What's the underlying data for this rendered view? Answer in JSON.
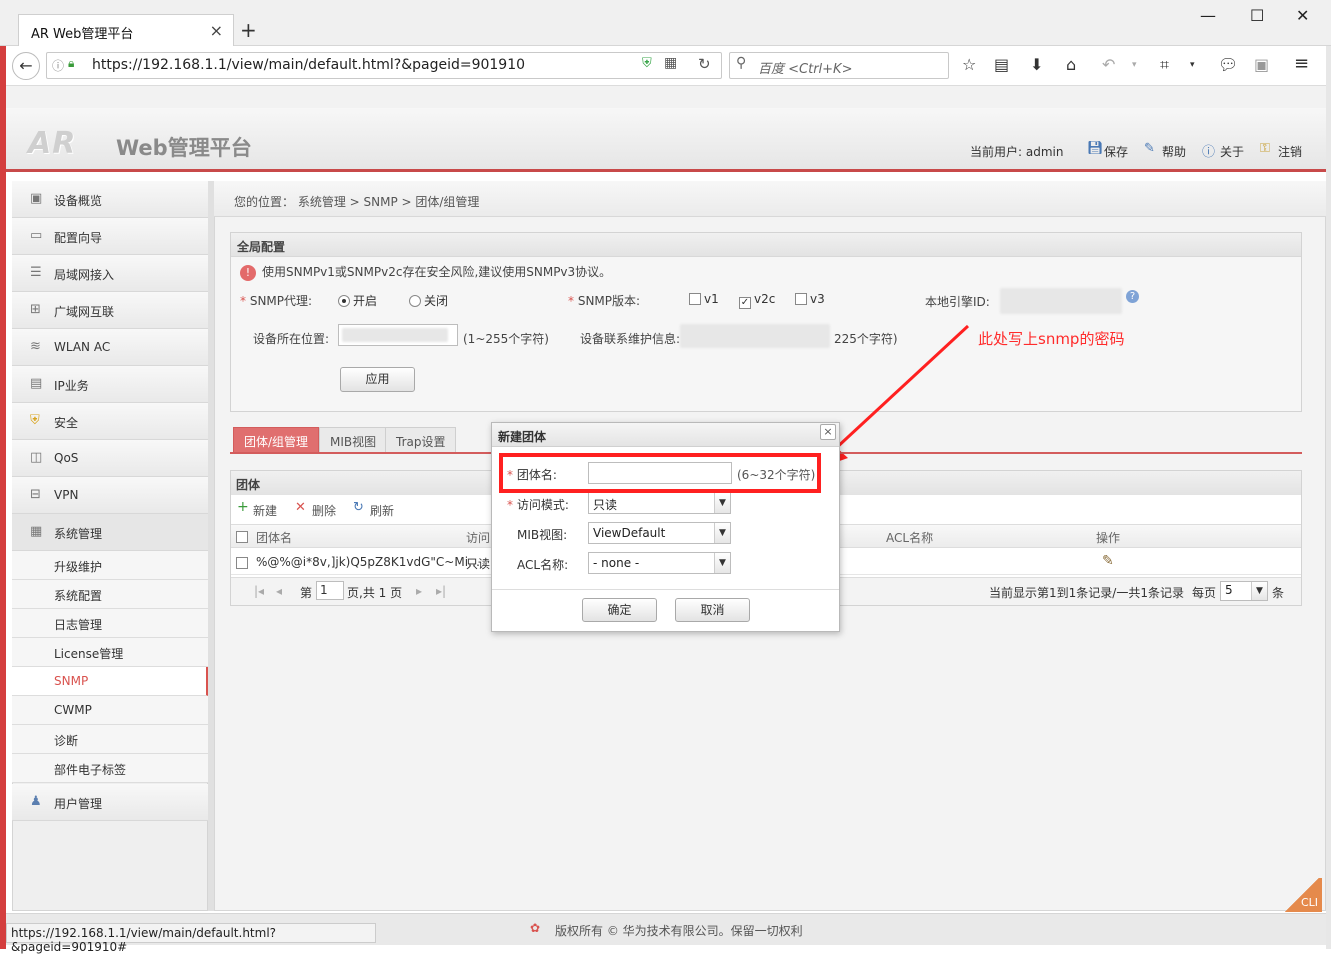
{
  "browser": {
    "tab_title": "AR Web管理平台",
    "url": "https://192.168.1.1/view/main/default.html?&pageid=901910",
    "search_placeholder": "百度 <Ctrl+K>",
    "status_url": "https://192.168.1.1/view/main/default.html?&pageid=901910#"
  },
  "header": {
    "logo": "AR",
    "title": "Web管理平台",
    "current_user": "当前用户: admin",
    "save": "保存",
    "help": "帮助",
    "about": "关于",
    "logout": "注销"
  },
  "sidebar": {
    "items": [
      "设备概览",
      "配置向导",
      "局域网接入",
      "广域网互联",
      "WLAN AC",
      "IP业务",
      "安全",
      "QoS",
      "VPN",
      "系统管理"
    ],
    "sub_items": [
      "升级维护",
      "系统配置",
      "日志管理",
      "License管理",
      "SNMP",
      "CWMP",
      "诊断",
      "部件电子标签"
    ],
    "active_sub": "SNMP",
    "last_item": "用户管理"
  },
  "breadcrumb": "您的位置： 系统管理 > SNMP > 团体/组管理",
  "global_config": {
    "title": "全局配置",
    "warning": "使用SNMPv1或SNMPv2c存在安全风险,建议使用SNMPv3协议。",
    "snmp_agent_label": "SNMP代理:",
    "on": "开启",
    "off": "关闭",
    "snmp_version_label": "SNMP版本:",
    "v1": "v1",
    "v2c": "v2c",
    "v3": "v3",
    "engine_id_label": "本地引擎ID:",
    "location_label": "设备所在位置:",
    "location_hint": "(1~255个字符)",
    "contact_label": "设备联系维护信息:",
    "contact_hint": "225个字符)",
    "apply": "应用"
  },
  "annotation": "此处写上snmp的密码",
  "tabs": [
    "团体/组管理",
    "MIB视图",
    "Trap设置"
  ],
  "grid": {
    "title": "团体",
    "new": "新建",
    "delete": "删除",
    "refresh": "刷新",
    "columns": [
      "团体名",
      "访问",
      "ACL名称",
      "操作"
    ],
    "row": {
      "name": "%@%@i*8v,]jk)Q5pZ8K1vdG\"C~Mi…",
      "access": "只读"
    },
    "page_label_before": "第",
    "page_value": "1",
    "page_label_after": "页,共 1 页",
    "record_info": "当前显示第1到1条记录/一共1条记录",
    "per_page": "每页",
    "per_page_value": "5",
    "per_page_unit": "条"
  },
  "dialog": {
    "title": "新建团体",
    "name_label": "团体名:",
    "name_hint": "(6~32个字符)",
    "access_label": "访问模式:",
    "access_value": "只读",
    "mib_label": "MIB视图:",
    "mib_value": "ViewDefault",
    "acl_label": "ACL名称:",
    "acl_value": "- none -",
    "ok": "确定",
    "cancel": "取消"
  },
  "footer": "版权所有 © 华为技术有限公司。保留一切权利",
  "cli": "CLI",
  "colors": {
    "accent": "#d35c5c",
    "annotation": "#ff2020"
  }
}
